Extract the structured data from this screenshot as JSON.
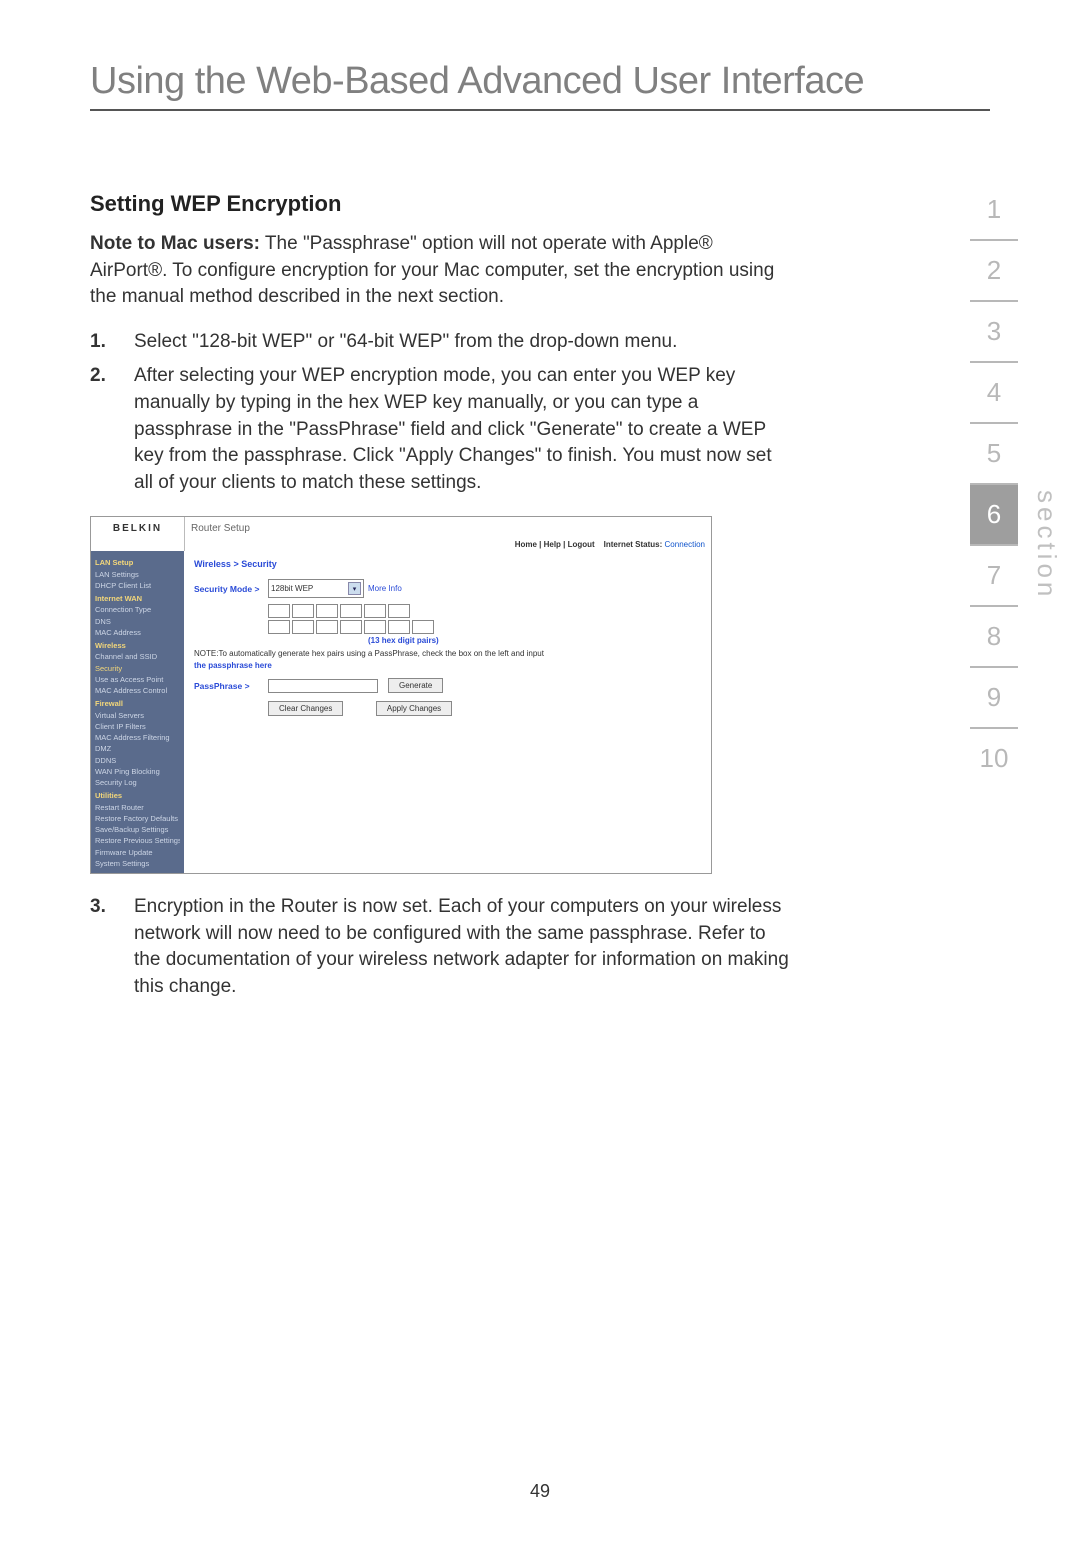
{
  "page_title": "Using the Web-Based Advanced User Interface",
  "subhead": "Setting WEP Encryption",
  "note_label": "Note to Mac users:",
  "note_body": " The \"Passphrase\" option will not operate with Apple® AirPort®. To configure encryption for your Mac computer, set the encryption using the manual method described in the next section.",
  "steps": [
    {
      "n": "1.",
      "t": "Select \"128-bit WEP\" or \"64-bit WEP\" from the drop-down menu."
    },
    {
      "n": "2.",
      "t": "After selecting your WEP encryption mode, you can enter you WEP key manually by typing in the hex WEP key manually, or you can type a passphrase in the \"PassPhrase\" field and click \"Generate\" to create a WEP key from the passphrase. Click \"Apply Changes\" to finish. You must now set all of your clients to match these settings."
    },
    {
      "n": "3.",
      "t": "Encryption in the Router is now set. Each of your computers on your wireless network will now need to be configured with the same passphrase. Refer to the documentation of your wireless network adapter for information on making this change."
    }
  ],
  "ss": {
    "brand": "BELKIN",
    "router_setup": "Router Setup",
    "meta_links": "Home | Help | Logout",
    "meta_status_label": "Internet Status:",
    "meta_status_value": "Connection",
    "breadcrumb": "Wireless > Security",
    "sidebar": {
      "lan_setup": "LAN Setup",
      "lan_settings": "LAN Settings",
      "dhcp": "DHCP Client List",
      "internet_wan": "Internet WAN",
      "conn_type": "Connection Type",
      "dns": "DNS",
      "mac_addr": "MAC Address",
      "wireless": "Wireless",
      "channel": "Channel and SSID",
      "security": "Security",
      "use_ap": "Use as Access Point",
      "mac_ctrl": "MAC Address Control",
      "firewall": "Firewall",
      "vservers": "Virtual Servers",
      "cip": "Client IP Filters",
      "macfilter": "MAC Address Filtering",
      "dmz": "DMZ",
      "ddns": "DDNS",
      "wanping": "WAN Ping Blocking",
      "seclog": "Security Log",
      "utilities": "Utilities",
      "restart": "Restart Router",
      "restore_def": "Restore Factory Defaults",
      "savebackup": "Save/Backup Settings",
      "restore_prev": "Restore Previous Settings",
      "fwupdate": "Firmware Update",
      "sysset": "System Settings"
    },
    "security_mode_label": "Security Mode >",
    "security_mode_value": "128bit WEP",
    "more_info": "More Info",
    "hex_caption": "(13 hex digit pairs)",
    "note_line": "NOTE:To automatically generate hex pairs using a PassPhrase, check the box on the left and input",
    "note_line2": "the passphrase here",
    "passphrase_label": "PassPhrase >",
    "generate": "Generate",
    "clear": "Clear Changes",
    "apply": "Apply Changes"
  },
  "secnav": [
    "1",
    "2",
    "3",
    "4",
    "5",
    "6",
    "7",
    "8",
    "9",
    "10"
  ],
  "secnav_active_index": 5,
  "section_label": "section",
  "page_number": "49"
}
